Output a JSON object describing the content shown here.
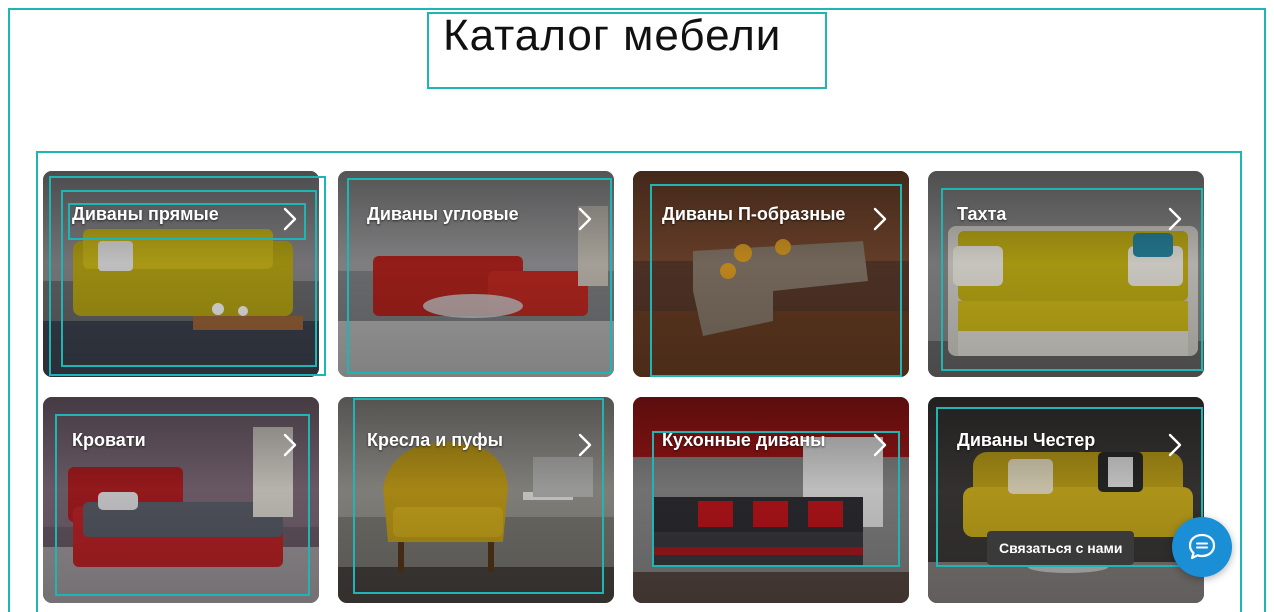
{
  "page": {
    "title": "Каталог мебели"
  },
  "catalog": {
    "items": [
      {
        "label": "Диваны прямые",
        "icon": "chevron-right-icon"
      },
      {
        "label": "Диваны угловые",
        "icon": "chevron-right-icon"
      },
      {
        "label": "Диваны П-образные",
        "icon": "chevron-right-icon"
      },
      {
        "label": "Тахта",
        "icon": "chevron-right-icon"
      },
      {
        "label": "Кровати",
        "icon": "chevron-right-icon"
      },
      {
        "label": "Кресла и пуфы",
        "icon": "chevron-right-icon"
      },
      {
        "label": "Кухонные диваны",
        "icon": "chevron-right-icon"
      },
      {
        "label": "Диваны Честер",
        "icon": "chevron-right-icon"
      }
    ]
  },
  "chat": {
    "label": "Связаться с нами",
    "icon": "chat-bubble-icon"
  },
  "colors": {
    "outline": "#1fb5b5",
    "chat_button": "#1a8fd6",
    "chat_badge": "#3a3a3a"
  }
}
